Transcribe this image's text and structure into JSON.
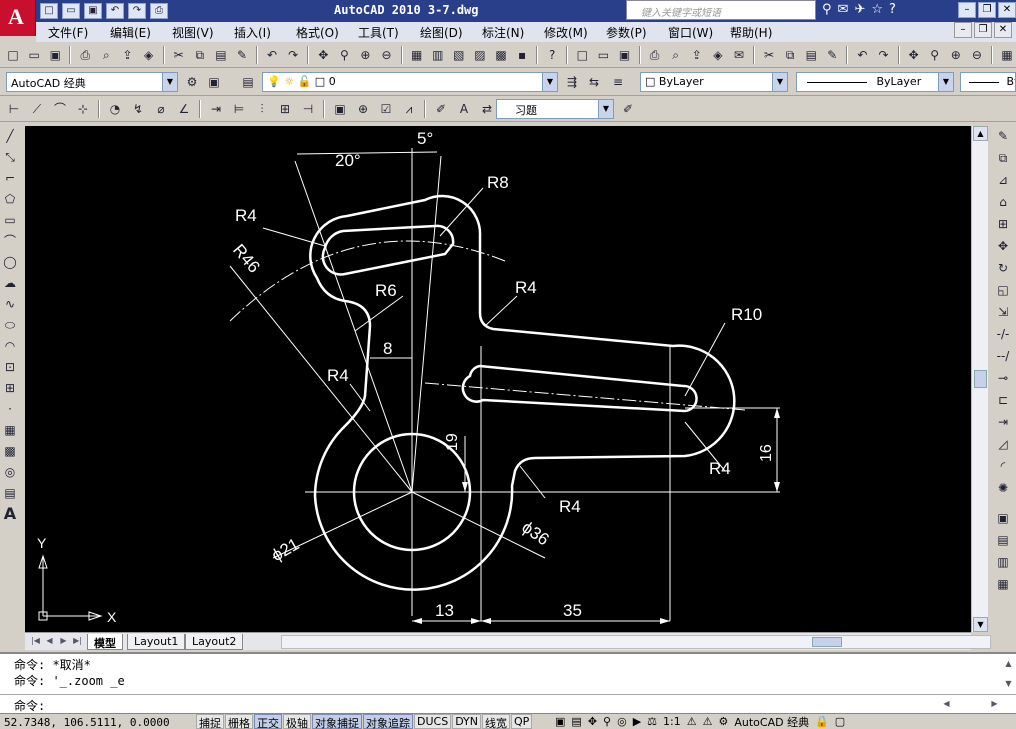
{
  "app": {
    "logo_letter": "A",
    "title": "AutoCAD 2010   3-7.dwg",
    "search_placeholder": "键入关键字或短语"
  },
  "quick_access": [
    "new-icon",
    "open-icon",
    "save-icon",
    "undo-icon",
    "redo-icon",
    "plot-icon"
  ],
  "menu": [
    "文件(F)",
    "编辑(E)",
    "视图(V)",
    "插入(I)",
    "格式(O)",
    "工具(T)",
    "绘图(D)",
    "标注(N)",
    "修改(M)",
    "参数(P)",
    "窗口(W)",
    "帮助(H)"
  ],
  "workspace": "AutoCAD 经典",
  "layer": "0",
  "color": "ByLayer",
  "linetype": "ByLayer",
  "lineweight": "By",
  "dimstyle": "习题",
  "drawing": {
    "labels": {
      "ang5": "5°",
      "ang20": "20°",
      "r8": "R8",
      "r4_top": "R4",
      "r46": "R46",
      "r6": "R6",
      "r4_mid": "R4",
      "d8": "8",
      "r10": "R10",
      "r4_left": "R4",
      "d19": "19",
      "d16": "16",
      "r4_right": "R4",
      "r4_bottom": "R4",
      "phi21": "ϕ21",
      "phi36": "ϕ36",
      "d13": "13",
      "d35": "35"
    },
    "ucs_x": "X",
    "ucs_y": "Y"
  },
  "layout_tabs": [
    "模型",
    "Layout1",
    "Layout2"
  ],
  "command": {
    "line1": "命令: *取消*",
    "line2": "命令: '_.zoom _e",
    "prompt": "命令:"
  },
  "status": {
    "coords": "52.7348,  106.5111,  0.0000",
    "buttons": [
      "捕捉",
      "栅格",
      "正交",
      "极轴",
      "对象捕捉",
      "对象追踪",
      "DUCS",
      "DYN",
      "线宽",
      "QP"
    ],
    "active": [
      "正交",
      "对象捕捉",
      "对象追踪"
    ],
    "scale": "1:1",
    "workspace": "AutoCAD 经典"
  }
}
